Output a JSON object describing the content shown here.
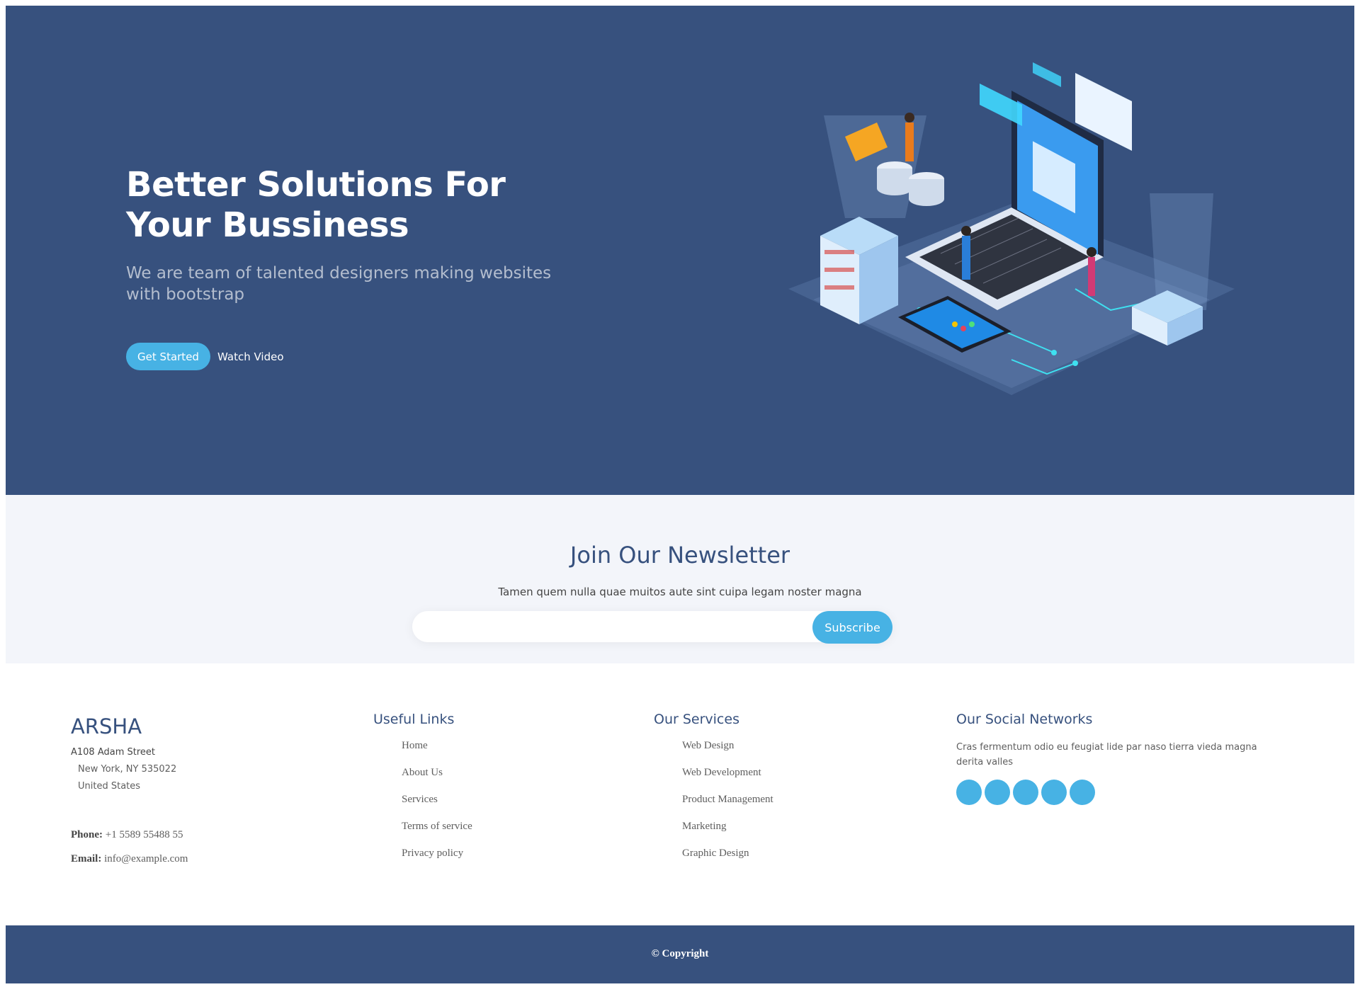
{
  "hero": {
    "title": "Better Solutions For Your Bussiness",
    "subtitle": "We are team of talented designers making websites with bootstrap",
    "get_started": "Get Started",
    "watch_video": "Watch Video",
    "illustration_icon": "laptop-data-center-illustration"
  },
  "newsletter": {
    "title": "Join Our Newsletter",
    "description": "Tamen quem nulla quae muitos aute sint cuipa legam noster magna",
    "input_value": "",
    "subscribe": "Subscribe"
  },
  "footer": {
    "brand": "ARSHA",
    "address": {
      "line1": "A108 Adam Street",
      "line2": "New York, NY 535022",
      "line3": "United States"
    },
    "phone_label": "Phone:",
    "phone": "+1 5589 55488 55",
    "email_label": "Email:",
    "email": "info@example.com",
    "useful_links": {
      "title": "Useful Links",
      "items": [
        "Home",
        "About Us",
        "Services",
        "Terms of service",
        "Privacy policy"
      ]
    },
    "services": {
      "title": "Our Services",
      "items": [
        "Web Design",
        "Web Development",
        "Product Management",
        "Marketing",
        "Graphic Design"
      ]
    },
    "social": {
      "title": "Our Social Networks",
      "description": "Cras fermentum odio eu feugiat lide par naso tierra vieda magna derita valles",
      "icons": [
        "twitter-icon",
        "facebook-icon",
        "instagram-icon",
        "skype-icon",
        "linkedin-icon"
      ]
    },
    "copyright": "© Copyright"
  },
  "colors": {
    "primary": "#37517e",
    "accent": "#47b2e4",
    "light_bg": "#f3f5fa"
  }
}
